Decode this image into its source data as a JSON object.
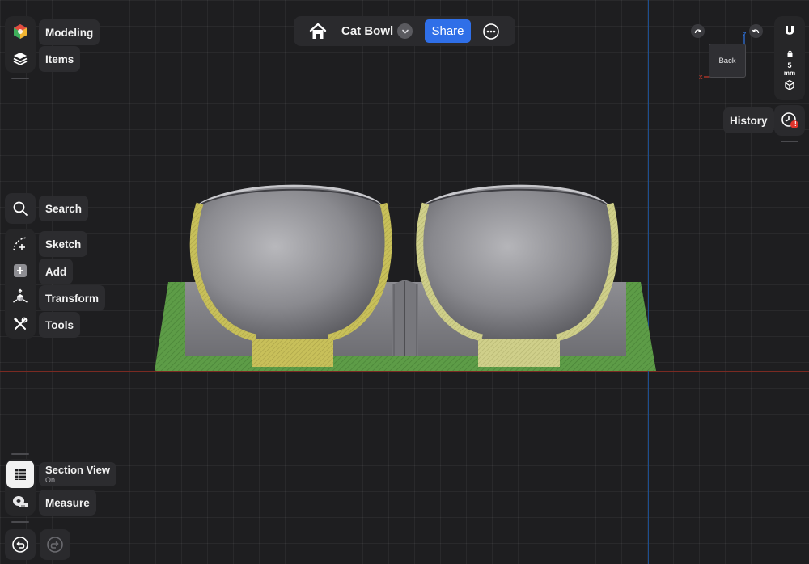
{
  "document": {
    "title": "Cat Bowl"
  },
  "toolbar": {
    "share_label": "Share"
  },
  "left_panel": {
    "modeling_label": "Modeling",
    "items_label": "Items",
    "search_label": "Search",
    "sketch_label": "Sketch",
    "add_label": "Add",
    "transform_label": "Transform",
    "tools_label": "Tools",
    "section_view_label": "Section View",
    "section_view_state": "On",
    "measure_label": "Measure"
  },
  "right_panel": {
    "view_cube_label": "Back",
    "snap_value": "5",
    "snap_unit": "mm",
    "history_label": "History",
    "history_badge": "!"
  },
  "axis_labels": {
    "x": "x",
    "z": "z"
  },
  "colors": {
    "accent": "#2f6fe8",
    "section_cut_fill": "#5a9a45",
    "section_highlight": "#c9c25a",
    "x_axis": "#c0392b",
    "z_axis": "#2e6fd6",
    "badge": "#e0342c"
  }
}
